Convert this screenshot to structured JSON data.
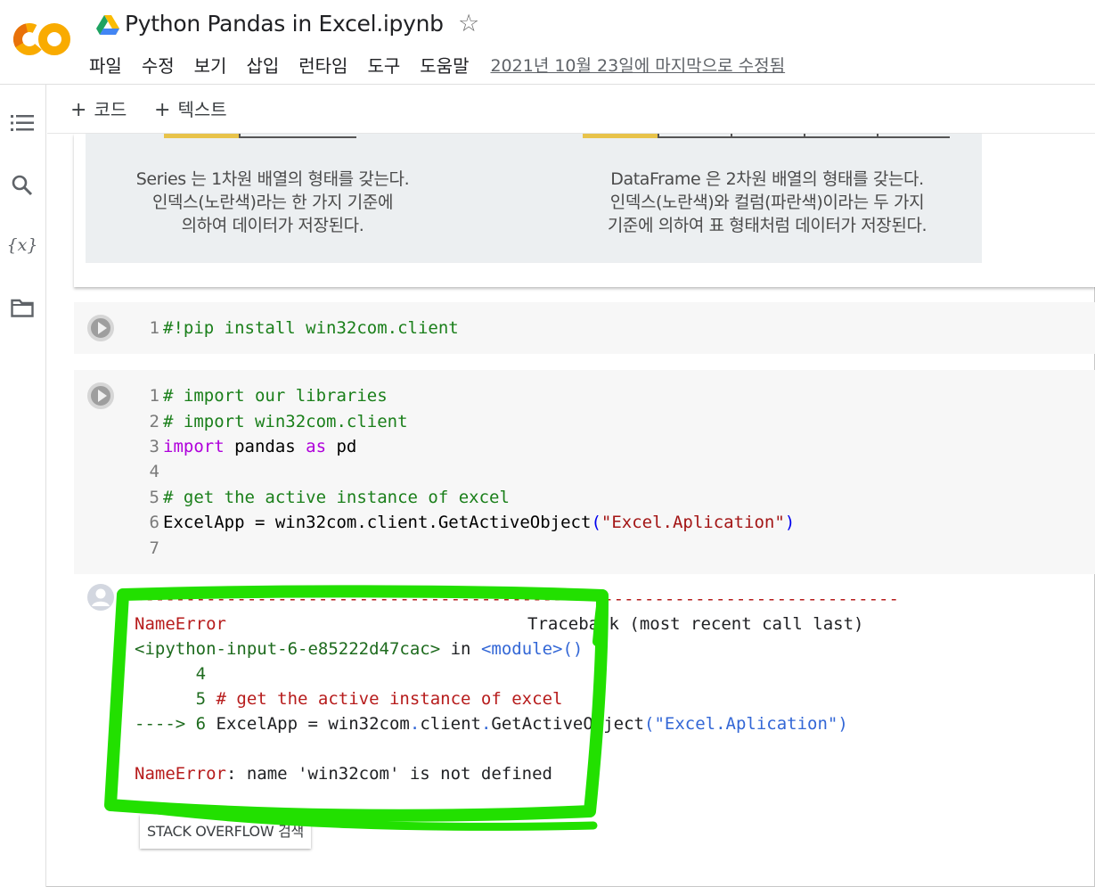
{
  "header": {
    "title": "Python Pandas in Excel.ipynb",
    "menu": [
      "파일",
      "수정",
      "보기",
      "삽입",
      "런타임",
      "도구",
      "도움말"
    ],
    "last_edited": "2021년 10월 23일에 마지막으로 수정됨"
  },
  "toolbar": {
    "add_code": "코드",
    "add_text": "텍스트"
  },
  "sidebar": {
    "icons": [
      "table-of-contents-icon",
      "search-icon",
      "variables-icon",
      "files-icon"
    ],
    "variables_glyph": "{x}"
  },
  "text_cell": {
    "caption_left": [
      "Series 는 1차원 배열의 형태를 갖는다.",
      "인덱스(노란색)라는 한 가지 기준에",
      "의하여 데이터가 저장된다."
    ],
    "caption_right": [
      "DataFrame 은 2차원 배열의 형태를 갖는다.",
      "인덱스(노란색)와 컬럼(파란색)이라는 두 가지",
      "기준에 의하여 표 형태처럼 데이터가 저장된다."
    ]
  },
  "cell1": {
    "lines": [
      {
        "n": "1",
        "comment": "#!pip install win32com.client"
      }
    ]
  },
  "cell2": {
    "lines": [
      {
        "n": "1",
        "comment": "# import our libraries"
      },
      {
        "n": "2",
        "comment": "# import win32com.client"
      },
      {
        "n": "3",
        "kw1": "import",
        "mid": " pandas ",
        "kw2": "as",
        "tail": " pd"
      },
      {
        "n": "4"
      },
      {
        "n": "5",
        "comment": "# get the active instance of excel"
      },
      {
        "n": "6",
        "pre": "ExcelApp = win32com.client.GetActiveObject",
        "open": "(",
        "str": "\"Excel.Aplication\"",
        "close": ")"
      },
      {
        "n": "7"
      }
    ]
  },
  "output": {
    "dashes": "---------------------------------------------------------------------------",
    "err_name": "NameError",
    "traceback": "Traceback (most recent call last)",
    "input_ref": "<ipython-input-6-e85222d47cac>",
    "in_word": " in ",
    "module": "<module>",
    "module_parens": "()",
    "tb_line4": "      4",
    "tb_line5_num": "      5 ",
    "tb_line5_code": "# get the active instance of excel",
    "tb_arrow": "----> 6 ",
    "tb_line6_a": "ExcelApp = win32com",
    "tb_line6_dot1": ".",
    "tb_line6_b": "client",
    "tb_line6_dot2": ".",
    "tb_line6_c": "GetActiveObject",
    "tb_line6_open": "(",
    "tb_line6_str": "\"Excel.Aplication\"",
    "tb_line6_close": ")",
    "err_label": "NameError",
    "err_msg": ": name 'win32com' is not defined"
  },
  "stackoverflow_button": "STACK OVERFLOW 검색",
  "colors": {
    "highlight": "#22e000",
    "colab_orange": "#f9ab00",
    "colab_dark_orange": "#e8710a"
  }
}
